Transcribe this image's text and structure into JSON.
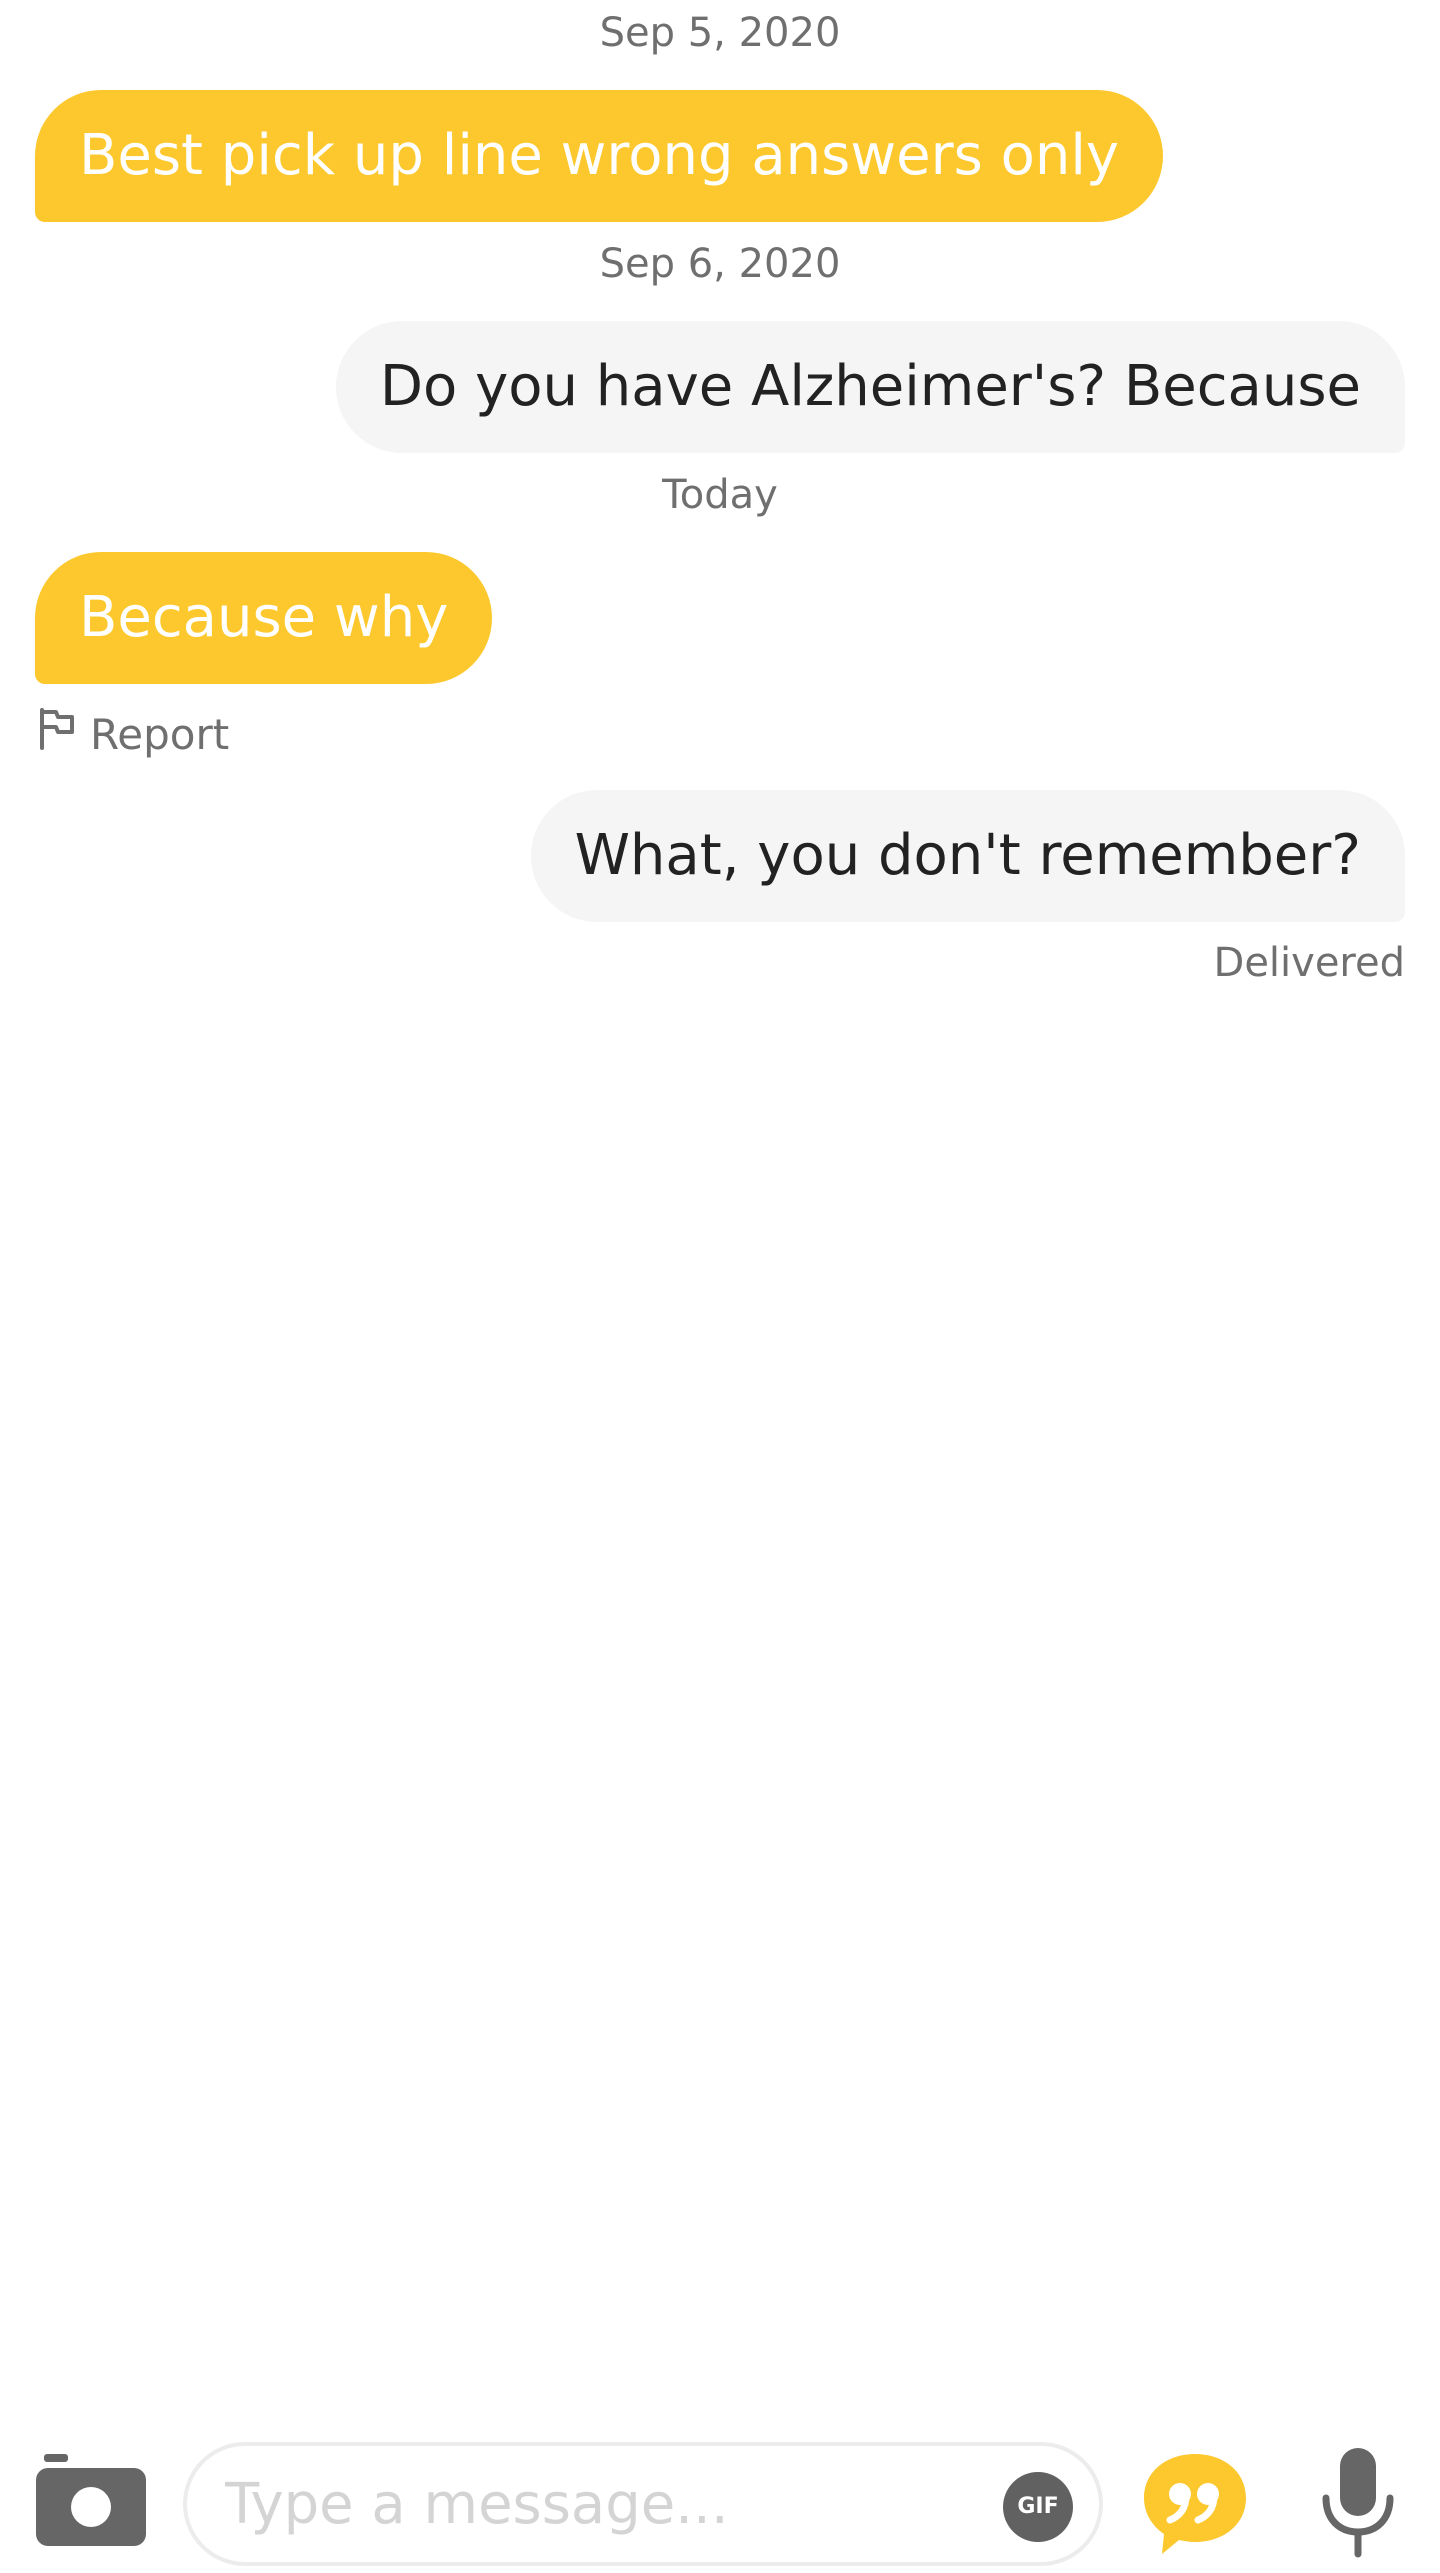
{
  "messages": [
    {
      "type": "date",
      "text": "Sep 5, 2020"
    },
    {
      "type": "incoming",
      "text": "Best pick up line wrong answers only"
    },
    {
      "type": "date",
      "text": "Sep 6, 2020"
    },
    {
      "type": "outgoing",
      "text": "Do you have Alzheimer's? Because"
    },
    {
      "type": "date",
      "text": "Today"
    },
    {
      "type": "incoming",
      "text": "Because why"
    },
    {
      "type": "outgoing",
      "text": "What, you don't remember?"
    }
  ],
  "report": {
    "label": "Report",
    "icon": "flag-icon"
  },
  "status": {
    "delivered": "Delivered"
  },
  "composer": {
    "placeholder": "Type a message...",
    "value": "",
    "gif_label": "GIF",
    "icons": [
      "camera-icon",
      "quote-icon",
      "microphone-icon"
    ]
  },
  "colors": {
    "incoming_bubble": "#fdc82d",
    "outgoing_bubble": "#f5f5f5",
    "accent": "#fdc82d",
    "muted_text": "#6f6f6f"
  }
}
